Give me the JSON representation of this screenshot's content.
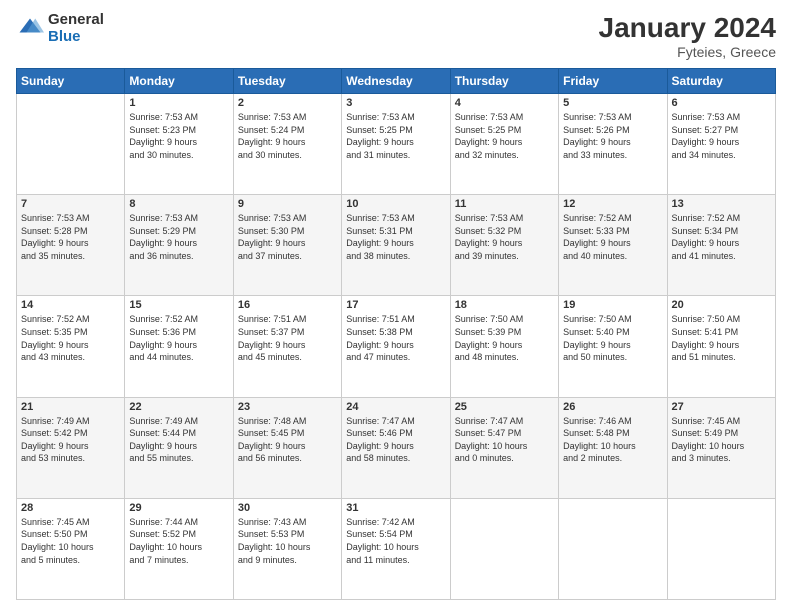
{
  "logo": {
    "general": "General",
    "blue": "Blue"
  },
  "title": "January 2024",
  "subtitle": "Fyteies, Greece",
  "days_of_week": [
    "Sunday",
    "Monday",
    "Tuesday",
    "Wednesday",
    "Thursday",
    "Friday",
    "Saturday"
  ],
  "weeks": [
    [
      {
        "num": "",
        "info": ""
      },
      {
        "num": "1",
        "info": "Sunrise: 7:53 AM\nSunset: 5:23 PM\nDaylight: 9 hours\nand 30 minutes."
      },
      {
        "num": "2",
        "info": "Sunrise: 7:53 AM\nSunset: 5:24 PM\nDaylight: 9 hours\nand 30 minutes."
      },
      {
        "num": "3",
        "info": "Sunrise: 7:53 AM\nSunset: 5:25 PM\nDaylight: 9 hours\nand 31 minutes."
      },
      {
        "num": "4",
        "info": "Sunrise: 7:53 AM\nSunset: 5:25 PM\nDaylight: 9 hours\nand 32 minutes."
      },
      {
        "num": "5",
        "info": "Sunrise: 7:53 AM\nSunset: 5:26 PM\nDaylight: 9 hours\nand 33 minutes."
      },
      {
        "num": "6",
        "info": "Sunrise: 7:53 AM\nSunset: 5:27 PM\nDaylight: 9 hours\nand 34 minutes."
      }
    ],
    [
      {
        "num": "7",
        "info": "Sunrise: 7:53 AM\nSunset: 5:28 PM\nDaylight: 9 hours\nand 35 minutes."
      },
      {
        "num": "8",
        "info": "Sunrise: 7:53 AM\nSunset: 5:29 PM\nDaylight: 9 hours\nand 36 minutes."
      },
      {
        "num": "9",
        "info": "Sunrise: 7:53 AM\nSunset: 5:30 PM\nDaylight: 9 hours\nand 37 minutes."
      },
      {
        "num": "10",
        "info": "Sunrise: 7:53 AM\nSunset: 5:31 PM\nDaylight: 9 hours\nand 38 minutes."
      },
      {
        "num": "11",
        "info": "Sunrise: 7:53 AM\nSunset: 5:32 PM\nDaylight: 9 hours\nand 39 minutes."
      },
      {
        "num": "12",
        "info": "Sunrise: 7:52 AM\nSunset: 5:33 PM\nDaylight: 9 hours\nand 40 minutes."
      },
      {
        "num": "13",
        "info": "Sunrise: 7:52 AM\nSunset: 5:34 PM\nDaylight: 9 hours\nand 41 minutes."
      }
    ],
    [
      {
        "num": "14",
        "info": "Sunrise: 7:52 AM\nSunset: 5:35 PM\nDaylight: 9 hours\nand 43 minutes."
      },
      {
        "num": "15",
        "info": "Sunrise: 7:52 AM\nSunset: 5:36 PM\nDaylight: 9 hours\nand 44 minutes."
      },
      {
        "num": "16",
        "info": "Sunrise: 7:51 AM\nSunset: 5:37 PM\nDaylight: 9 hours\nand 45 minutes."
      },
      {
        "num": "17",
        "info": "Sunrise: 7:51 AM\nSunset: 5:38 PM\nDaylight: 9 hours\nand 47 minutes."
      },
      {
        "num": "18",
        "info": "Sunrise: 7:50 AM\nSunset: 5:39 PM\nDaylight: 9 hours\nand 48 minutes."
      },
      {
        "num": "19",
        "info": "Sunrise: 7:50 AM\nSunset: 5:40 PM\nDaylight: 9 hours\nand 50 minutes."
      },
      {
        "num": "20",
        "info": "Sunrise: 7:50 AM\nSunset: 5:41 PM\nDaylight: 9 hours\nand 51 minutes."
      }
    ],
    [
      {
        "num": "21",
        "info": "Sunrise: 7:49 AM\nSunset: 5:42 PM\nDaylight: 9 hours\nand 53 minutes."
      },
      {
        "num": "22",
        "info": "Sunrise: 7:49 AM\nSunset: 5:44 PM\nDaylight: 9 hours\nand 55 minutes."
      },
      {
        "num": "23",
        "info": "Sunrise: 7:48 AM\nSunset: 5:45 PM\nDaylight: 9 hours\nand 56 minutes."
      },
      {
        "num": "24",
        "info": "Sunrise: 7:47 AM\nSunset: 5:46 PM\nDaylight: 9 hours\nand 58 minutes."
      },
      {
        "num": "25",
        "info": "Sunrise: 7:47 AM\nSunset: 5:47 PM\nDaylight: 10 hours\nand 0 minutes."
      },
      {
        "num": "26",
        "info": "Sunrise: 7:46 AM\nSunset: 5:48 PM\nDaylight: 10 hours\nand 2 minutes."
      },
      {
        "num": "27",
        "info": "Sunrise: 7:45 AM\nSunset: 5:49 PM\nDaylight: 10 hours\nand 3 minutes."
      }
    ],
    [
      {
        "num": "28",
        "info": "Sunrise: 7:45 AM\nSunset: 5:50 PM\nDaylight: 10 hours\nand 5 minutes."
      },
      {
        "num": "29",
        "info": "Sunrise: 7:44 AM\nSunset: 5:52 PM\nDaylight: 10 hours\nand 7 minutes."
      },
      {
        "num": "30",
        "info": "Sunrise: 7:43 AM\nSunset: 5:53 PM\nDaylight: 10 hours\nand 9 minutes."
      },
      {
        "num": "31",
        "info": "Sunrise: 7:42 AM\nSunset: 5:54 PM\nDaylight: 10 hours\nand 11 minutes."
      },
      {
        "num": "",
        "info": ""
      },
      {
        "num": "",
        "info": ""
      },
      {
        "num": "",
        "info": ""
      }
    ]
  ]
}
